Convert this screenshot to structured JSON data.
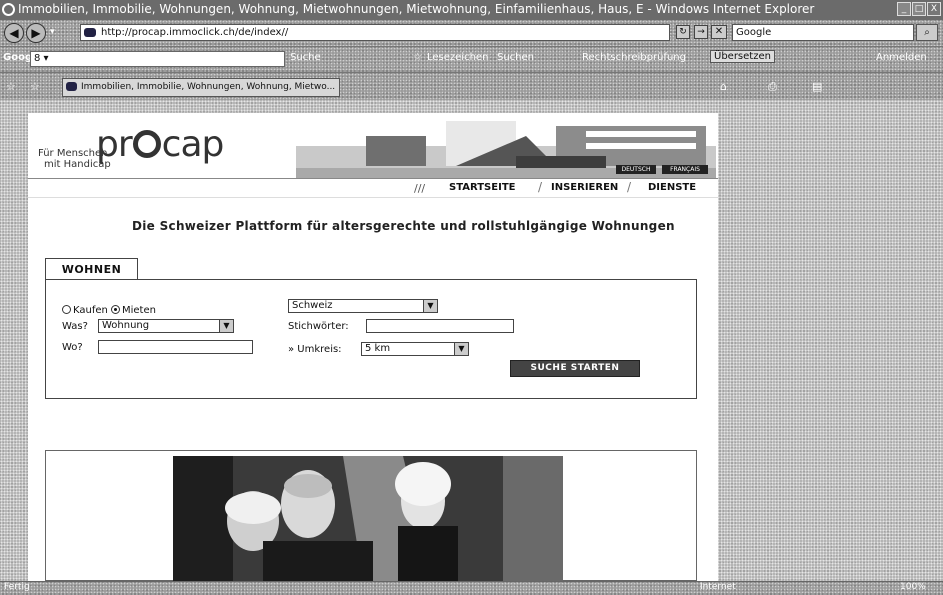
{
  "window": {
    "title": "Immobilien, Immobilie, Wohnungen, Wohnung, Mietwohnungen, Mietwohnung, Einfamilienhaus, Haus, E - Windows Internet Explorer",
    "min": "_",
    "max": "□",
    "close": "X"
  },
  "address_bar": {
    "url": "http://procap.immoclick.ch/de/index//",
    "search_engine": "Google"
  },
  "google_toolbar": {
    "brand": "Google",
    "search_value": "8 ▾",
    "search_button": "Suche",
    "bookmarks": "Lesezeichen",
    "check": "Suchen",
    "spellcheck": "Rechtschreibprüfung",
    "translate": "Übersetzen",
    "signin": "Anmelden"
  },
  "tab": {
    "title": "Immobilien, Immobilie, Wohnungen, Wohnung, Mietwo..."
  },
  "site": {
    "tagline_line1": "Für Menschen",
    "tagline_line2": "mit Handicap",
    "logo_left": "pr",
    "logo_right": "cap",
    "lang_de": "DEUTSCH",
    "lang_fr": "FRANÇAIS",
    "nav_prefix": "///",
    "nav": [
      "STARTSEITE",
      "INSERIEREN",
      "DIENSTE"
    ],
    "headline": "Die Schweizer Plattform für altersgerechte und rollstuhlgängige Wohnungen"
  },
  "search_form": {
    "tab_label": "WOHNEN",
    "radio_buy": "Kaufen",
    "radio_rent": "Mieten",
    "radio_selected": "Mieten",
    "label_what": "Was?",
    "what_value": "Wohnung",
    "label_where": "Wo?",
    "where_value": "",
    "country_value": "Schweiz",
    "label_keywords": "Stichwörter:",
    "keywords_value": "",
    "label_radius": "» Umkreis:",
    "radius_value": "5 km",
    "submit": "SUCHE STARTEN"
  },
  "status_bar": {
    "status": "Fertig",
    "zone": "Internet",
    "zoom": "100%"
  },
  "icons": [
    "ie-icon",
    "back-arrow-icon",
    "forward-arrow-icon",
    "refresh-icon",
    "stop-icon",
    "search-icon",
    "star-icon",
    "home-icon",
    "printer-icon",
    "dropdown-arrow-icon"
  ]
}
